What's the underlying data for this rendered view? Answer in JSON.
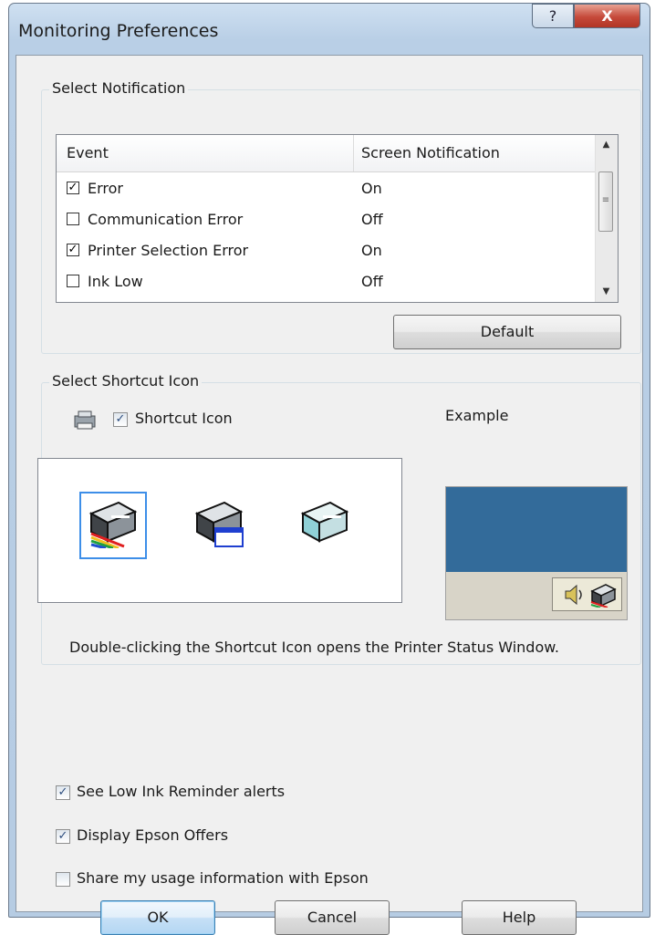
{
  "window": {
    "title": "Monitoring Preferences",
    "help_button_label": "?",
    "close_button_label": "X"
  },
  "notification": {
    "group_label": "Select Notification",
    "columns": {
      "event": "Event",
      "screen": "Screen Notification"
    },
    "rows": [
      {
        "event": "Error",
        "checked": true,
        "mark": "✓",
        "value": "On"
      },
      {
        "event": "Communication Error",
        "checked": false,
        "mark": "",
        "value": "Off"
      },
      {
        "event": "Printer Selection Error",
        "checked": true,
        "mark": "✓",
        "value": "On"
      },
      {
        "event": "Ink Low",
        "checked": false,
        "mark": "",
        "value": "Off"
      }
    ],
    "default_button": "Default"
  },
  "shortcut": {
    "group_label": "Select Shortcut Icon",
    "checkbox_label": "Shortcut Icon",
    "checkbox_checked": true,
    "checkbox_mark": "✓",
    "example_label": "Example",
    "icons": [
      "printer-rainbow-icon",
      "printer-window-icon",
      "printer-plain-icon"
    ],
    "selected_icon": 0,
    "description": "Double-clicking the Shortcut Icon opens the Printer Status Window."
  },
  "options": [
    {
      "label": "See Low Ink Reminder alerts",
      "checked": true,
      "mark": "✓"
    },
    {
      "label": "Display Epson Offers",
      "checked": true,
      "mark": "✓"
    },
    {
      "label": "Share my usage information with Epson",
      "checked": false,
      "mark": ""
    }
  ],
  "buttons": {
    "ok": "OK",
    "cancel": "Cancel",
    "help": "Help"
  },
  "colors": {
    "titlebar": "#b9cfe6",
    "close_button": "#c5493a",
    "example_desktop": "#336b9a",
    "selected_icon_border": "#3d8ee8"
  }
}
